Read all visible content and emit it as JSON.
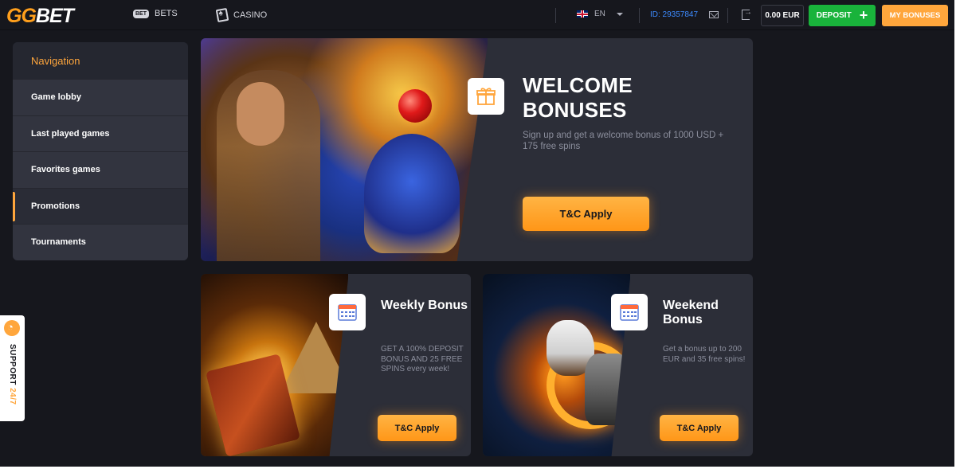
{
  "header": {
    "logo_part1": "GG",
    "logo_part2": "BET",
    "bets_chip": "BET",
    "bets_label": "BETS",
    "casino_label": "CASINO",
    "language": "EN",
    "user_id": "ID: 29357847",
    "balance": "0.00 EUR",
    "deposit_label": "DEPOSIT",
    "deposit_icon": "+",
    "my_bonuses_label": "MY BONUSES"
  },
  "sidebar": {
    "title": "Navigation",
    "items": [
      {
        "label": "Game lobby"
      },
      {
        "label": "Last played games"
      },
      {
        "label": "Favorites games"
      },
      {
        "label": "Promotions"
      },
      {
        "label": "Tournaments"
      }
    ]
  },
  "support": {
    "label": "SUPPORT ",
    "label_accent": "24/7"
  },
  "hero": {
    "title": "WELCOME BONUSES",
    "description": "Sign up and get a welcome bonus of 1000 USD + 175 free spins",
    "button": "T&C Apply"
  },
  "cards": [
    {
      "title": "Weekly Bonus",
      "description": "GET A 100% DEPOSIT BONUS AND 25 FREE SPINS every week!",
      "button": "T&C Apply"
    },
    {
      "title": "Weekend Bonus",
      "description": "Get a bonus up to 200 EUR and 35 free spins!",
      "button": "T&C Apply"
    }
  ],
  "colors": {
    "accent": "#ffa63c",
    "deposit": "#19b33b",
    "background": "#16171d",
    "panel": "#2c2e38",
    "user_id": "#3d8bff"
  },
  "icons": {
    "bets": "bet-chip-icon",
    "casino": "playing-card-icon",
    "mail": "envelope-icon",
    "logout": "logout-icon",
    "hero": "gift-icon",
    "cards": "calendar-icon",
    "support": "headset-icon"
  }
}
